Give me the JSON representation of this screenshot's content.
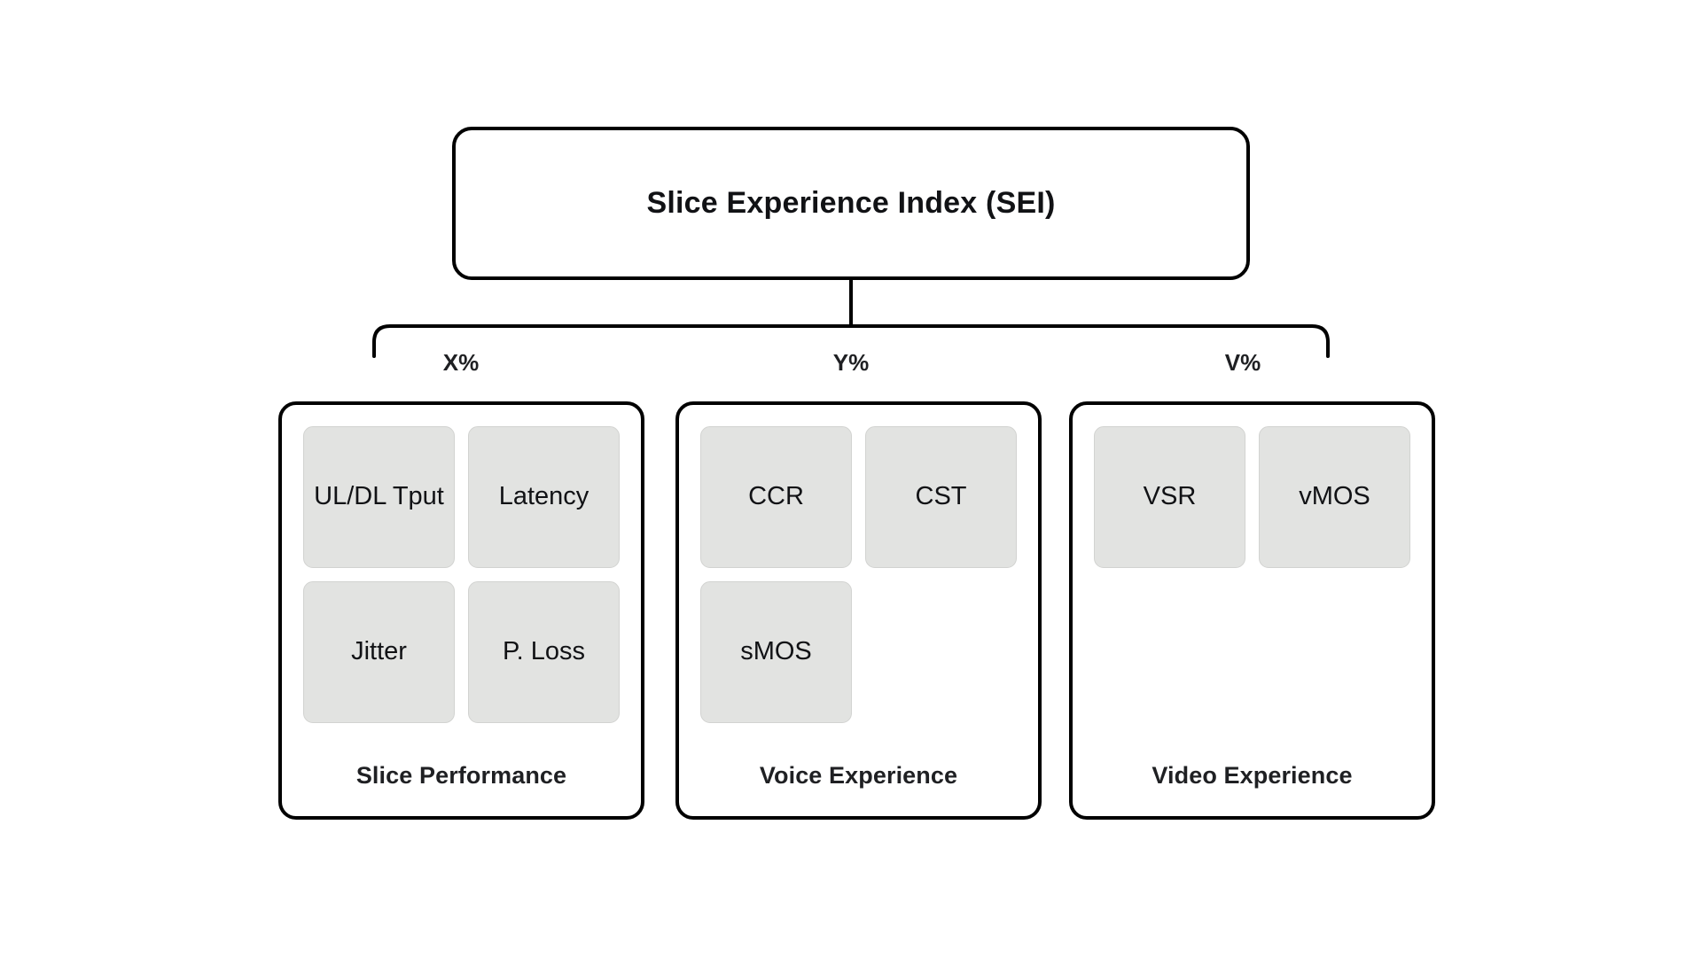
{
  "diagram": {
    "root": {
      "title": "Slice Experience Index (SEI)"
    },
    "weights": [
      {
        "label": "X%"
      },
      {
        "label": "Y%"
      },
      {
        "label": "V%"
      }
    ],
    "categories": [
      {
        "title": "Slice Performance",
        "metrics": [
          {
            "label": "UL/DL Tput"
          },
          {
            "label": "Latency"
          },
          {
            "label": "Jitter"
          },
          {
            "label": "P. Loss"
          }
        ]
      },
      {
        "title": "Voice Experience",
        "metrics": [
          {
            "label": "CCR"
          },
          {
            "label": "CST"
          },
          {
            "label": "sMOS"
          },
          {
            "label": ""
          }
        ]
      },
      {
        "title": "Video Experience",
        "metrics": [
          {
            "label": "VSR"
          },
          {
            "label": "vMOS"
          },
          {
            "label": ""
          },
          {
            "label": ""
          }
        ]
      }
    ],
    "colors": {
      "background": "#ffffff",
      "stroke": "#000000",
      "tile_fill": "#e2e3e1",
      "tile_border": "#d2d3d1",
      "text": "#111215",
      "title_text": "#1f2023"
    }
  }
}
